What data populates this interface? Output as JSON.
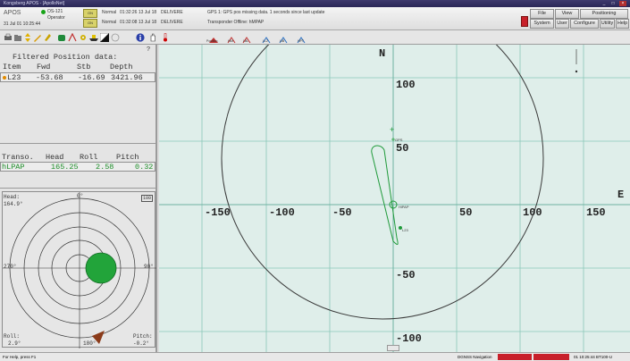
{
  "window": {
    "title": "Kongsberg APOS - [ApolloNet]"
  },
  "header": {
    "app_name": "APOS",
    "station": "OS-121",
    "role": "Operator",
    "date_time": "31 Jul 01  10:25:44",
    "row1": {
      "badge": "ON",
      "mode": "Normal",
      "time": "01:32:26 13 Jul 18",
      "source": "DELIVERE",
      "message": "GPS 1: GPS pos missing data. 1 seconds since last update"
    },
    "row2": {
      "badge": "ON",
      "mode": "Normal",
      "time": "01:32:08 13 Jul 18",
      "source": "DELIVERE",
      "message": "Transponder Offline: hMPAP"
    },
    "menu": [
      "File",
      "View",
      "Positioning",
      "System",
      "User",
      "Configure",
      "Utility",
      "Help"
    ]
  },
  "toolbar": {
    "icons": [
      "print-icon",
      "folder-icon",
      "move-icon",
      "edit-icon",
      "pencil-icon",
      "transponder-icon",
      "antenna-icon",
      "gear-icon",
      "ship-icon",
      "contrast-icon",
      "circle-icon",
      "info-icon",
      "hand-icon",
      "thermometer-icon"
    ],
    "group_labels": [
      "Position",
      "HiM",
      "LBL",
      "LL2",
      "LIB",
      "HPT"
    ]
  },
  "position_panel": {
    "title": "Filtered Position data:",
    "headers": [
      "Item",
      "Fwd",
      "Stb",
      "Depth"
    ],
    "row": {
      "item": "L23",
      "fwd": "-53.68",
      "stb": "-16.69",
      "depth": "3421.96"
    },
    "scroll_marker": "?"
  },
  "transponder_panel": {
    "headers": [
      "Transo.",
      "Head",
      "Roll",
      "Pitch"
    ],
    "row": {
      "name": "hLPAP",
      "head": "165.25",
      "roll": "2.58",
      "pitch": "0.32"
    }
  },
  "polar": {
    "heading_label": "Head:",
    "heading_value": "164.9°",
    "top": "0°",
    "right": "90°",
    "left": "270°",
    "bottom": "180°",
    "roll_label": "Roll:",
    "roll_value": "2.9°",
    "pitch_label": "Pitch:",
    "pitch_value": "-0.2°",
    "scale_badge": "100"
  },
  "plot": {
    "north_label": "N",
    "east_label": "E",
    "x_ticks": [
      "-150",
      "-100",
      "-50",
      "50",
      "100",
      "150"
    ],
    "y_ticks": [
      "100",
      "50",
      "-50",
      "-100"
    ],
    "gps_label": "GPS",
    "position_label": "HiPAP",
    "target_label": "L23",
    "grid_color": "#8ac7b8",
    "track_color": "#1f9a3a"
  },
  "statusbar": {
    "left": "For Help, press F1",
    "mid": "DGNSS Navigation",
    "right": "01 10:25:44   BT100-U"
  }
}
